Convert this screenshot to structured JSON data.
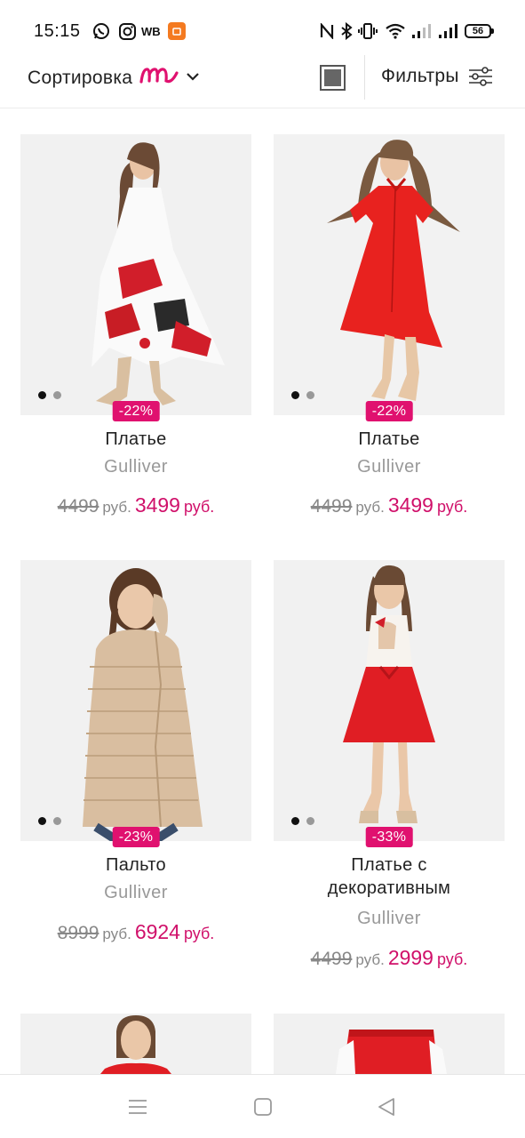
{
  "status_bar": {
    "time": "15:15",
    "app_icons": [
      "whatsapp-icon",
      "instagram-icon",
      "wb-icon",
      "shopping-app-icon"
    ],
    "wb_label": "WB",
    "system_icons": [
      "nfc-icon",
      "bluetooth-icon",
      "vibrate-icon",
      "wifi-icon",
      "signal-icon",
      "signal-icon"
    ],
    "battery": "56"
  },
  "toolbar": {
    "sort_label": "Сортировка",
    "filters_label": "Фильтры"
  },
  "colors": {
    "accent": "#e0116f",
    "price": "#d0106a",
    "muted": "#999999"
  },
  "products": [
    {
      "title": "Платье",
      "brand": "Gulliver",
      "discount": "-22%",
      "old_price": "4499",
      "old_currency": "руб.",
      "new_price": "3499",
      "new_currency": "руб.",
      "photo_index": "1 of 2"
    },
    {
      "title": "Платье",
      "brand": "Gulliver",
      "discount": "-22%",
      "old_price": "4499",
      "old_currency": "руб.",
      "new_price": "3499",
      "new_currency": "руб.",
      "photo_index": "1 of 2"
    },
    {
      "title": "Пальто",
      "brand": "Gulliver",
      "discount": "-23%",
      "old_price": "8999",
      "old_currency": "руб.",
      "new_price": "6924",
      "new_currency": "руб.",
      "photo_index": "1 of 2"
    },
    {
      "title_line1": "Платье с",
      "title_line2": "декоративным",
      "brand": "Gulliver",
      "discount": "-33%",
      "old_price": "4499",
      "old_currency": "руб.",
      "new_price": "2999",
      "new_currency": "руб.",
      "photo_index": "1 of 2"
    }
  ],
  "nav_bar": {
    "buttons": [
      "menu-icon",
      "home-square-icon",
      "back-triangle-icon"
    ]
  }
}
